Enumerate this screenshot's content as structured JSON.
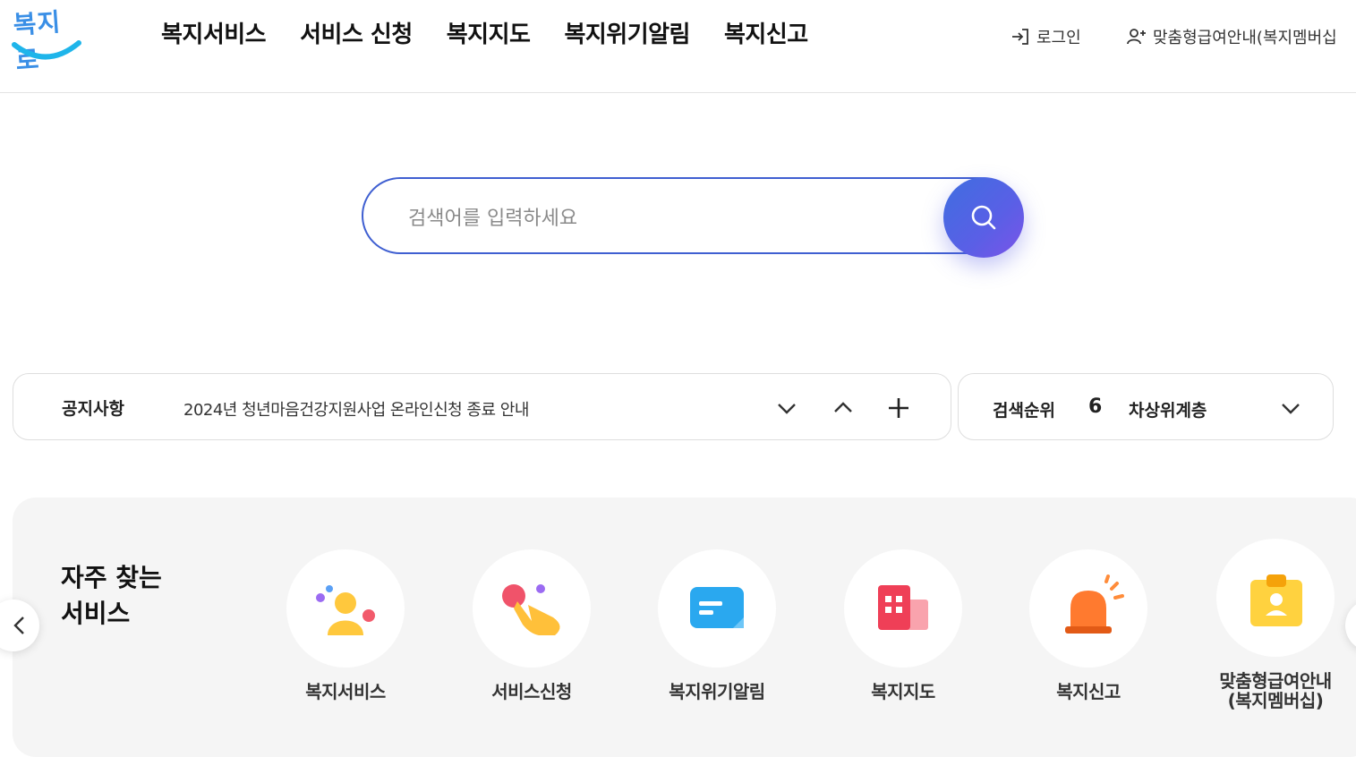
{
  "header": {
    "logo_text": "복지로",
    "nav": [
      "복지서비스",
      "서비스 신청",
      "복지지도",
      "복지위기알림",
      "복지신고"
    ],
    "login_label": "로그인",
    "membership_label": "맞춤형급여안내(복지멤버십"
  },
  "search": {
    "placeholder": "검색어를 입력하세요"
  },
  "notice": {
    "label": "공지사항",
    "text": "2024년 청년마음건강지원사업 온라인신청 종료 안내"
  },
  "rank": {
    "label": "검색순위",
    "number": "6",
    "keyword": "차상위계층"
  },
  "quick": {
    "title_line1": "자주 찾는",
    "title_line2": "서비스",
    "items": [
      {
        "label": "복지서비스",
        "icon": "people-icon"
      },
      {
        "label": "서비스신청",
        "icon": "hand-tap-icon"
      },
      {
        "label": "복지위기알림",
        "icon": "message-icon"
      },
      {
        "label": "복지지도",
        "icon": "building-map-icon"
      },
      {
        "label": "복지신고",
        "icon": "siren-icon"
      },
      {
        "label": "맞춤형급여안내",
        "label2": "(복지멤버십)",
        "icon": "id-badge-icon"
      }
    ]
  },
  "colors": {
    "accent": "#3f5fd1",
    "search_btn_start": "#3f6ee0",
    "search_btn_end": "#7b54e8",
    "panel_bg": "#f5f5f5"
  }
}
